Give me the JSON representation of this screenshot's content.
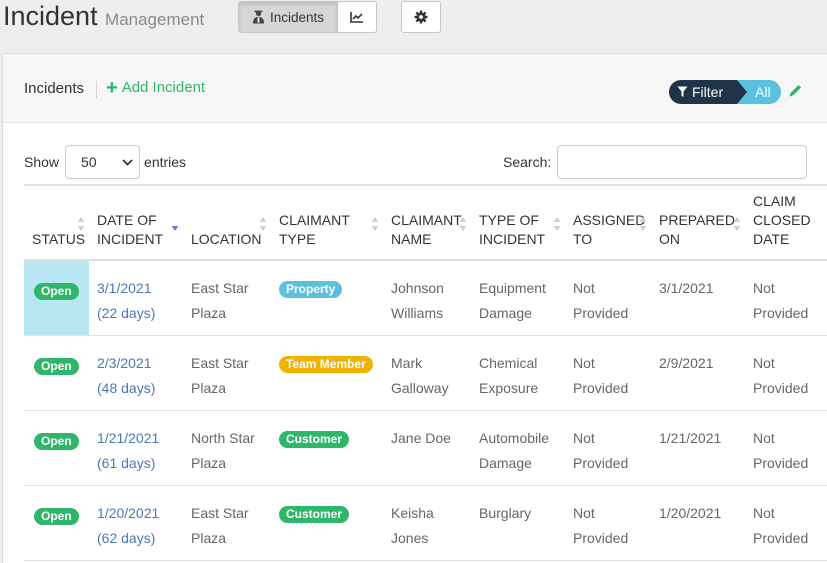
{
  "app": {
    "title_main": "Incident",
    "title_sub": "Management"
  },
  "nav": {
    "incidents_label": "Incidents"
  },
  "card": {
    "title": "Incidents",
    "add_label": "Add Incident"
  },
  "filter": {
    "label": "Filter",
    "value": "All"
  },
  "length": {
    "show_label": "Show",
    "value": "50",
    "entries_label": "entries"
  },
  "search": {
    "label": "Search:",
    "value": ""
  },
  "colors": {
    "green": "#2eb66b",
    "blue": "#5bc0de",
    "yellow": "#f0b400",
    "navy": "#1f3349",
    "selected": "#b8e6f3"
  },
  "columns": [
    {
      "line1": "",
      "line2": "STATUS"
    },
    {
      "line1": "DATE OF",
      "line2": "INCIDENT"
    },
    {
      "line1": "",
      "line2": "LOCATION"
    },
    {
      "line1": "CLAIMANT",
      "line2": "TYPE"
    },
    {
      "line1": "CLAIMANT",
      "line2": "NAME"
    },
    {
      "line1": "TYPE OF",
      "line2": "INCIDENT"
    },
    {
      "line1": "ASSIGNED",
      "line2": "TO"
    },
    {
      "line1": "PREPARED",
      "line2": "ON"
    },
    {
      "line0": "CLAIM",
      "line1": "CLOSED",
      "line2": "DATE"
    }
  ],
  "rows": [
    {
      "status": "Open",
      "date": "3/1/2021",
      "ago": "(22 days)",
      "loc1": "East Star",
      "loc2": "Plaza",
      "ctype": "Property",
      "ctype_color": "#5bc0de",
      "name1": "Johnson",
      "name2": "Williams",
      "itype1": "Equipment",
      "itype2": "Damage",
      "assigned1": "Not",
      "assigned2": "Provided",
      "prepared": "3/1/2021",
      "closed1": "Not",
      "closed2": "Provided"
    },
    {
      "status": "Open",
      "date": "2/3/2021",
      "ago": "(48 days)",
      "loc1": "East Star",
      "loc2": "Plaza",
      "ctype": "Team Member",
      "ctype_color": "#f0b400",
      "name1": "Mark",
      "name2": "Galloway",
      "itype1": "Chemical",
      "itype2": "Exposure",
      "assigned1": "Not",
      "assigned2": "Provided",
      "prepared": "2/9/2021",
      "closed1": "Not",
      "closed2": "Provided"
    },
    {
      "status": "Open",
      "date": "1/21/2021",
      "ago": "(61 days)",
      "loc1": "North Star",
      "loc2": "Plaza",
      "ctype": "Customer",
      "ctype_color": "#2eb66b",
      "name1": "Jane Doe",
      "name2": "",
      "itype1": "Automobile",
      "itype2": "Damage",
      "assigned1": "Not",
      "assigned2": "Provided",
      "prepared": "1/21/2021",
      "closed1": "Not",
      "closed2": "Provided"
    },
    {
      "status": "Open",
      "date": "1/20/2021",
      "ago": "(62 days)",
      "loc1": "East Star",
      "loc2": "Plaza",
      "ctype": "Customer",
      "ctype_color": "#2eb66b",
      "name1": "Keisha",
      "name2": "Jones",
      "itype1": "Burglary",
      "itype2": "",
      "assigned1": "Not",
      "assigned2": "Provided",
      "prepared": "1/20/2021",
      "closed1": "Not",
      "closed2": "Provided"
    }
  ]
}
